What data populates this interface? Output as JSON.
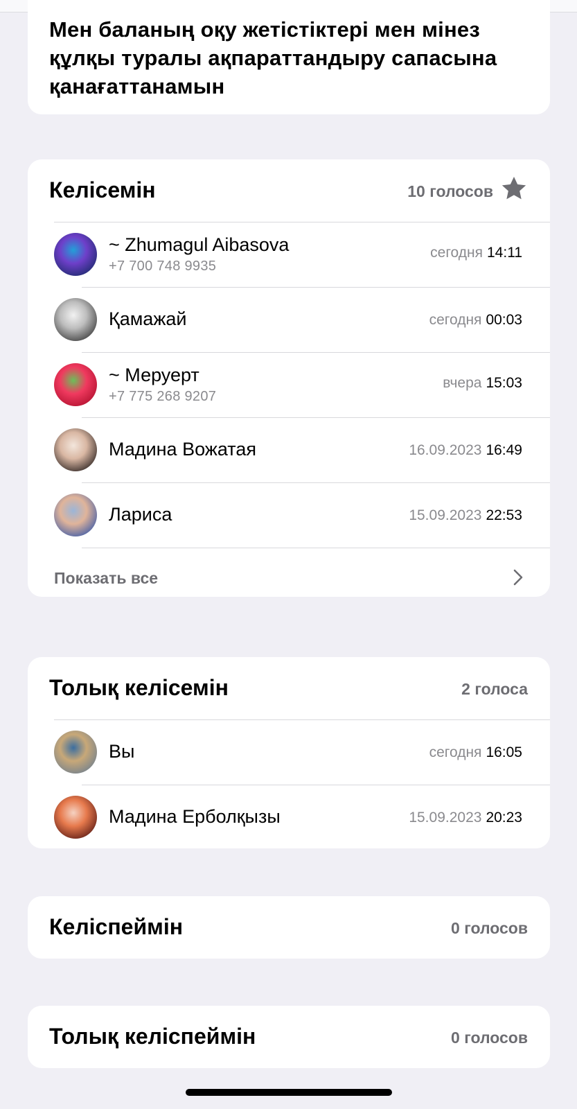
{
  "question": "Мен баланың оқу жетістіктері мен мінез құлқы туралы ақпараттандыру сапасына қанағаттанамын",
  "options": [
    {
      "title": "Келісемін",
      "count": "10 голосов",
      "starred": true,
      "voters": [
        {
          "name": "~ Zhumagul Aibasova",
          "phone": "+7 700 748 9935",
          "date": "сегодня",
          "time": "14:11",
          "avatar_colors": [
            "#1b2a6b",
            "#6e3fc9",
            "#22a0d8"
          ]
        },
        {
          "name": "Қамажай",
          "phone": "",
          "date": "сегодня",
          "time": "00:03",
          "avatar_colors": [
            "#3a3a3a",
            "#bdbdbd",
            "#f2f2f2"
          ]
        },
        {
          "name": "~ Меруерт",
          "phone": "+7 775 268 9207",
          "date": "вчера",
          "time": "15:03",
          "avatar_colors": [
            "#b0102e",
            "#f03a5f",
            "#6bbf59"
          ]
        },
        {
          "name": "Мадина Вожатая",
          "phone": "",
          "date": "16.09.2023",
          "time": "16:49",
          "avatar_colors": [
            "#2b2220",
            "#d9b7a3",
            "#f3e6dc"
          ]
        },
        {
          "name": "Лариса",
          "phone": "",
          "date": "15.09.2023",
          "time": "22:53",
          "avatar_colors": [
            "#3b5aa8",
            "#e0b49a",
            "#9bb5d8"
          ]
        }
      ],
      "show_all_label": "Показать все"
    },
    {
      "title": "Толық келісемін",
      "count": "2 голоса",
      "starred": false,
      "voters": [
        {
          "name": "Вы",
          "phone": "",
          "date": "сегодня",
          "time": "16:05",
          "avatar_colors": [
            "#6f7f8f",
            "#c8a878",
            "#3b6ea0"
          ]
        },
        {
          "name": "Мадина Ерболқызы",
          "phone": "",
          "date": "15.09.2023",
          "time": "20:23",
          "avatar_colors": [
            "#5a1a14",
            "#e77a4d",
            "#f5d2c2"
          ]
        }
      ]
    },
    {
      "title": "Келіспеймін",
      "count": "0 голосов",
      "starred": false,
      "voters": []
    },
    {
      "title": "Толық келіспеймін",
      "count": "0 голосов",
      "starred": false,
      "voters": []
    }
  ]
}
